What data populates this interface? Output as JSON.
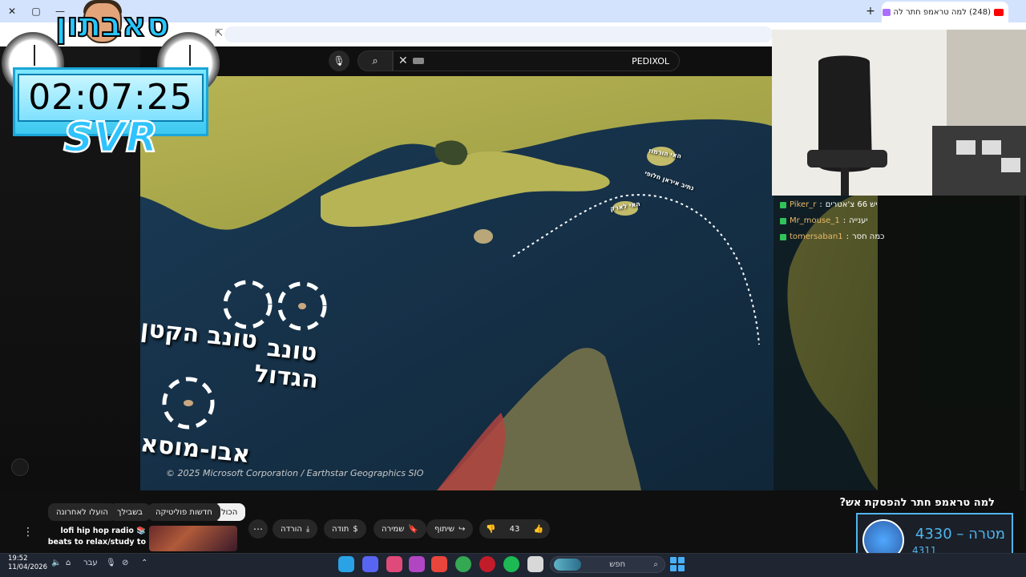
{
  "browser": {
    "tab_title": "(248) למה טראמפ חתר לה",
    "new_tab_label": "+",
    "window": {
      "minimize": "—",
      "maximize": "▢",
      "close": "✕"
    }
  },
  "overlay": {
    "streamer_name": "סאבתון",
    "timer": "02:07:25",
    "tag": "SVR"
  },
  "search": {
    "query": "PEDIXOL",
    "mic_icon": "mic-icon",
    "search_icon": "search-icon",
    "clear_icon": "close-icon"
  },
  "map": {
    "labels": {
      "tunb_small": "טונב הקטן",
      "tunb_big_line1": "טונב",
      "tunb_big_line2": "הגדול",
      "abu_musa": "אבו-מוסא",
      "hormuz_island": "האי הורמוז",
      "larak_island": "האי לארק",
      "route": "נתיב איראן חלופי"
    },
    "copyright": "© 2025 Microsoft Corporation / Earthstar Geographics  SIO"
  },
  "chat": {
    "messages": [
      {
        "user": "Piker_r",
        "text": "יש 66 צ'אטרים"
      },
      {
        "user": "1_Mr_mouse",
        "text": "יענייה"
      },
      {
        "user": "tomersaban1",
        "text": "כמה חסר"
      }
    ]
  },
  "filters": [
    "הכול",
    "חדשות פוליטיקה",
    "בשבילך",
    "הועלו לאחרונה"
  ],
  "actions": {
    "like_count": "43",
    "share": "שיתוף",
    "save": "שמירה",
    "thanks": "תודה",
    "download": "הורדה"
  },
  "side_video": {
    "title": "lofi hip hop radio 📚 beats to relax/study to"
  },
  "video": {
    "title": "למה טראמפ חתר להפסקת אש?"
  },
  "goal": {
    "label": "מטרה",
    "target": "4330",
    "current": "4311"
  },
  "taskbar": {
    "time": "19:52",
    "date": "11/04/2026",
    "lang": "עבר",
    "search_placeholder": "חפש",
    "notification_count": "1"
  }
}
